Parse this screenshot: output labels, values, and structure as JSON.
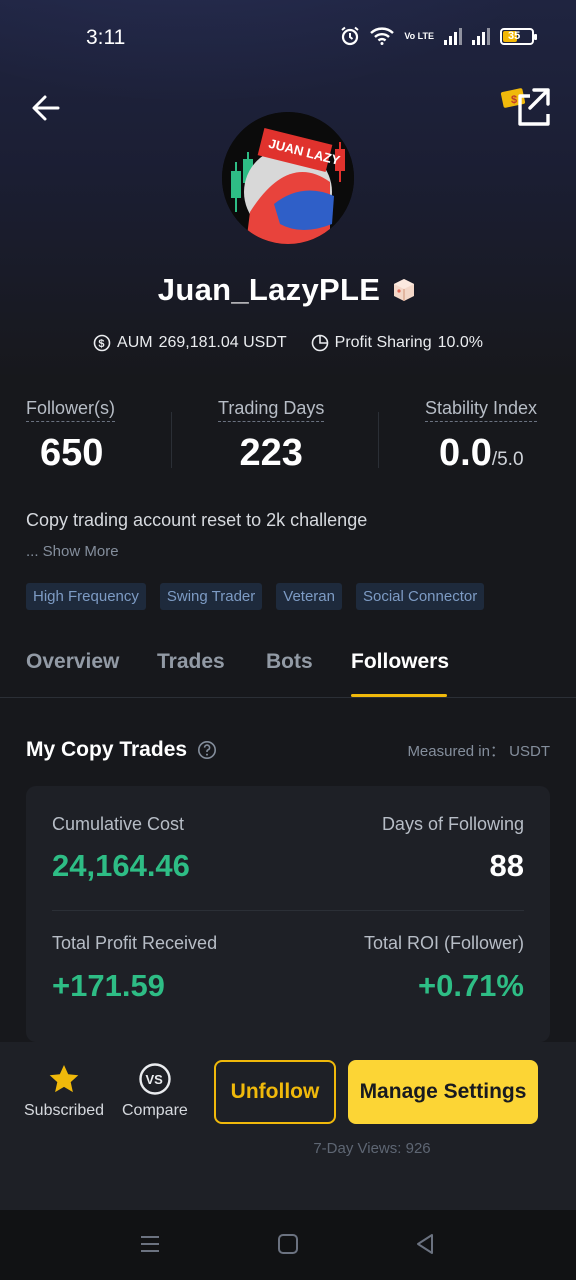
{
  "status_bar": {
    "time": "3:11",
    "volte_label": "Vo LTE",
    "battery_level": "35",
    "battery_color": "#f2b705"
  },
  "header": {
    "back_icon": "arrow-left-icon",
    "share_icon": "external-link-icon"
  },
  "profile": {
    "name": "Juan_LazyPLE",
    "avatar_text": "JUAN LAZY",
    "aum_label": "AUM",
    "aum_value": "269,181.04 USDT",
    "profit_sharing_label": "Profit Sharing",
    "profit_sharing_value": "10.0%",
    "stats": [
      {
        "label": "Follower(s)",
        "value": "650"
      },
      {
        "label": "Trading Days",
        "value": "223"
      },
      {
        "label": "Stability Index",
        "value": "0.0",
        "suffix": "/5.0"
      }
    ],
    "bio": "Copy trading account reset to 2k challenge",
    "show_more": "... Show More",
    "tags": [
      "High Frequency",
      "Swing Trader",
      "Veteran",
      "Social Connector"
    ]
  },
  "tabs": {
    "items": [
      "Overview",
      "Trades",
      "Bots",
      "Followers"
    ],
    "active": "Followers",
    "accent_color": "#f0b90b"
  },
  "copy_trades": {
    "title": "My Copy Trades",
    "measured_label": "Measured in：",
    "measured_unit": "USDT",
    "cumulative_cost_label": "Cumulative Cost",
    "cumulative_cost_value": "24,164.46",
    "days_following_label": "Days of Following",
    "days_following_value": "88",
    "total_profit_label": "Total Profit Received",
    "total_profit_value": "+171.59",
    "total_roi_label": "Total ROI (Follower)",
    "total_roi_value": "+0.71%",
    "positive_color": "#2ebd85"
  },
  "actions": {
    "subscribed_label": "Subscribed",
    "compare_label": "Compare",
    "unfollow_label": "Unfollow",
    "manage_label": "Manage Settings",
    "views_text": "7-Day Views: 926"
  },
  "nav_bar": {
    "icons": [
      "menu-icon",
      "home-square-icon",
      "back-triangle-icon"
    ]
  }
}
